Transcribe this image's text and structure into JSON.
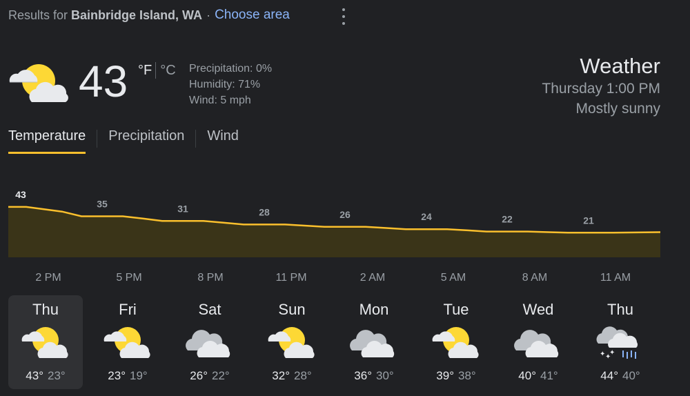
{
  "header": {
    "results_for": "Results for",
    "location": "Bainbridge Island, WA",
    "separator": "·",
    "choose_area": "Choose area"
  },
  "current": {
    "temp": "43",
    "unit_f": "°F",
    "unit_c": "°C",
    "precipitation": "Precipitation: 0%",
    "humidity": "Humidity: 71%",
    "wind": "Wind: 5 mph",
    "icon": "partly-sunny-icon"
  },
  "summary": {
    "title": "Weather",
    "time": "Thursday 1:00 PM",
    "condition": "Mostly sunny"
  },
  "tabs": [
    "Temperature",
    "Precipitation",
    "Wind"
  ],
  "chart_data": {
    "type": "area",
    "x": [
      "2 PM",
      "5 PM",
      "8 PM",
      "11 PM",
      "2 AM",
      "5 AM",
      "8 AM",
      "11 AM"
    ],
    "values": [
      43,
      35,
      31,
      28,
      26,
      24,
      22,
      21
    ],
    "point_labels": [
      "43",
      "35",
      "31",
      "28",
      "26",
      "24",
      "22",
      "21"
    ],
    "color": "#fbc02d",
    "fill": "#3a3418"
  },
  "days": [
    {
      "name": "Thu",
      "high": "43°",
      "low": "23°",
      "icon": "partly-sunny-icon"
    },
    {
      "name": "Fri",
      "high": "23°",
      "low": "19°",
      "icon": "partly-sunny-icon"
    },
    {
      "name": "Sat",
      "high": "26°",
      "low": "22°",
      "icon": "cloudy-icon"
    },
    {
      "name": "Sun",
      "high": "32°",
      "low": "28°",
      "icon": "partly-sunny-icon"
    },
    {
      "name": "Mon",
      "high": "36°",
      "low": "30°",
      "icon": "cloudy-icon"
    },
    {
      "name": "Tue",
      "high": "39°",
      "low": "38°",
      "icon": "partly-sunny-icon"
    },
    {
      "name": "Wed",
      "high": "40°",
      "low": "41°",
      "icon": "cloudy-icon"
    },
    {
      "name": "Thu",
      "high": "44°",
      "low": "40°",
      "icon": "rain-and-snow-icon"
    }
  ]
}
